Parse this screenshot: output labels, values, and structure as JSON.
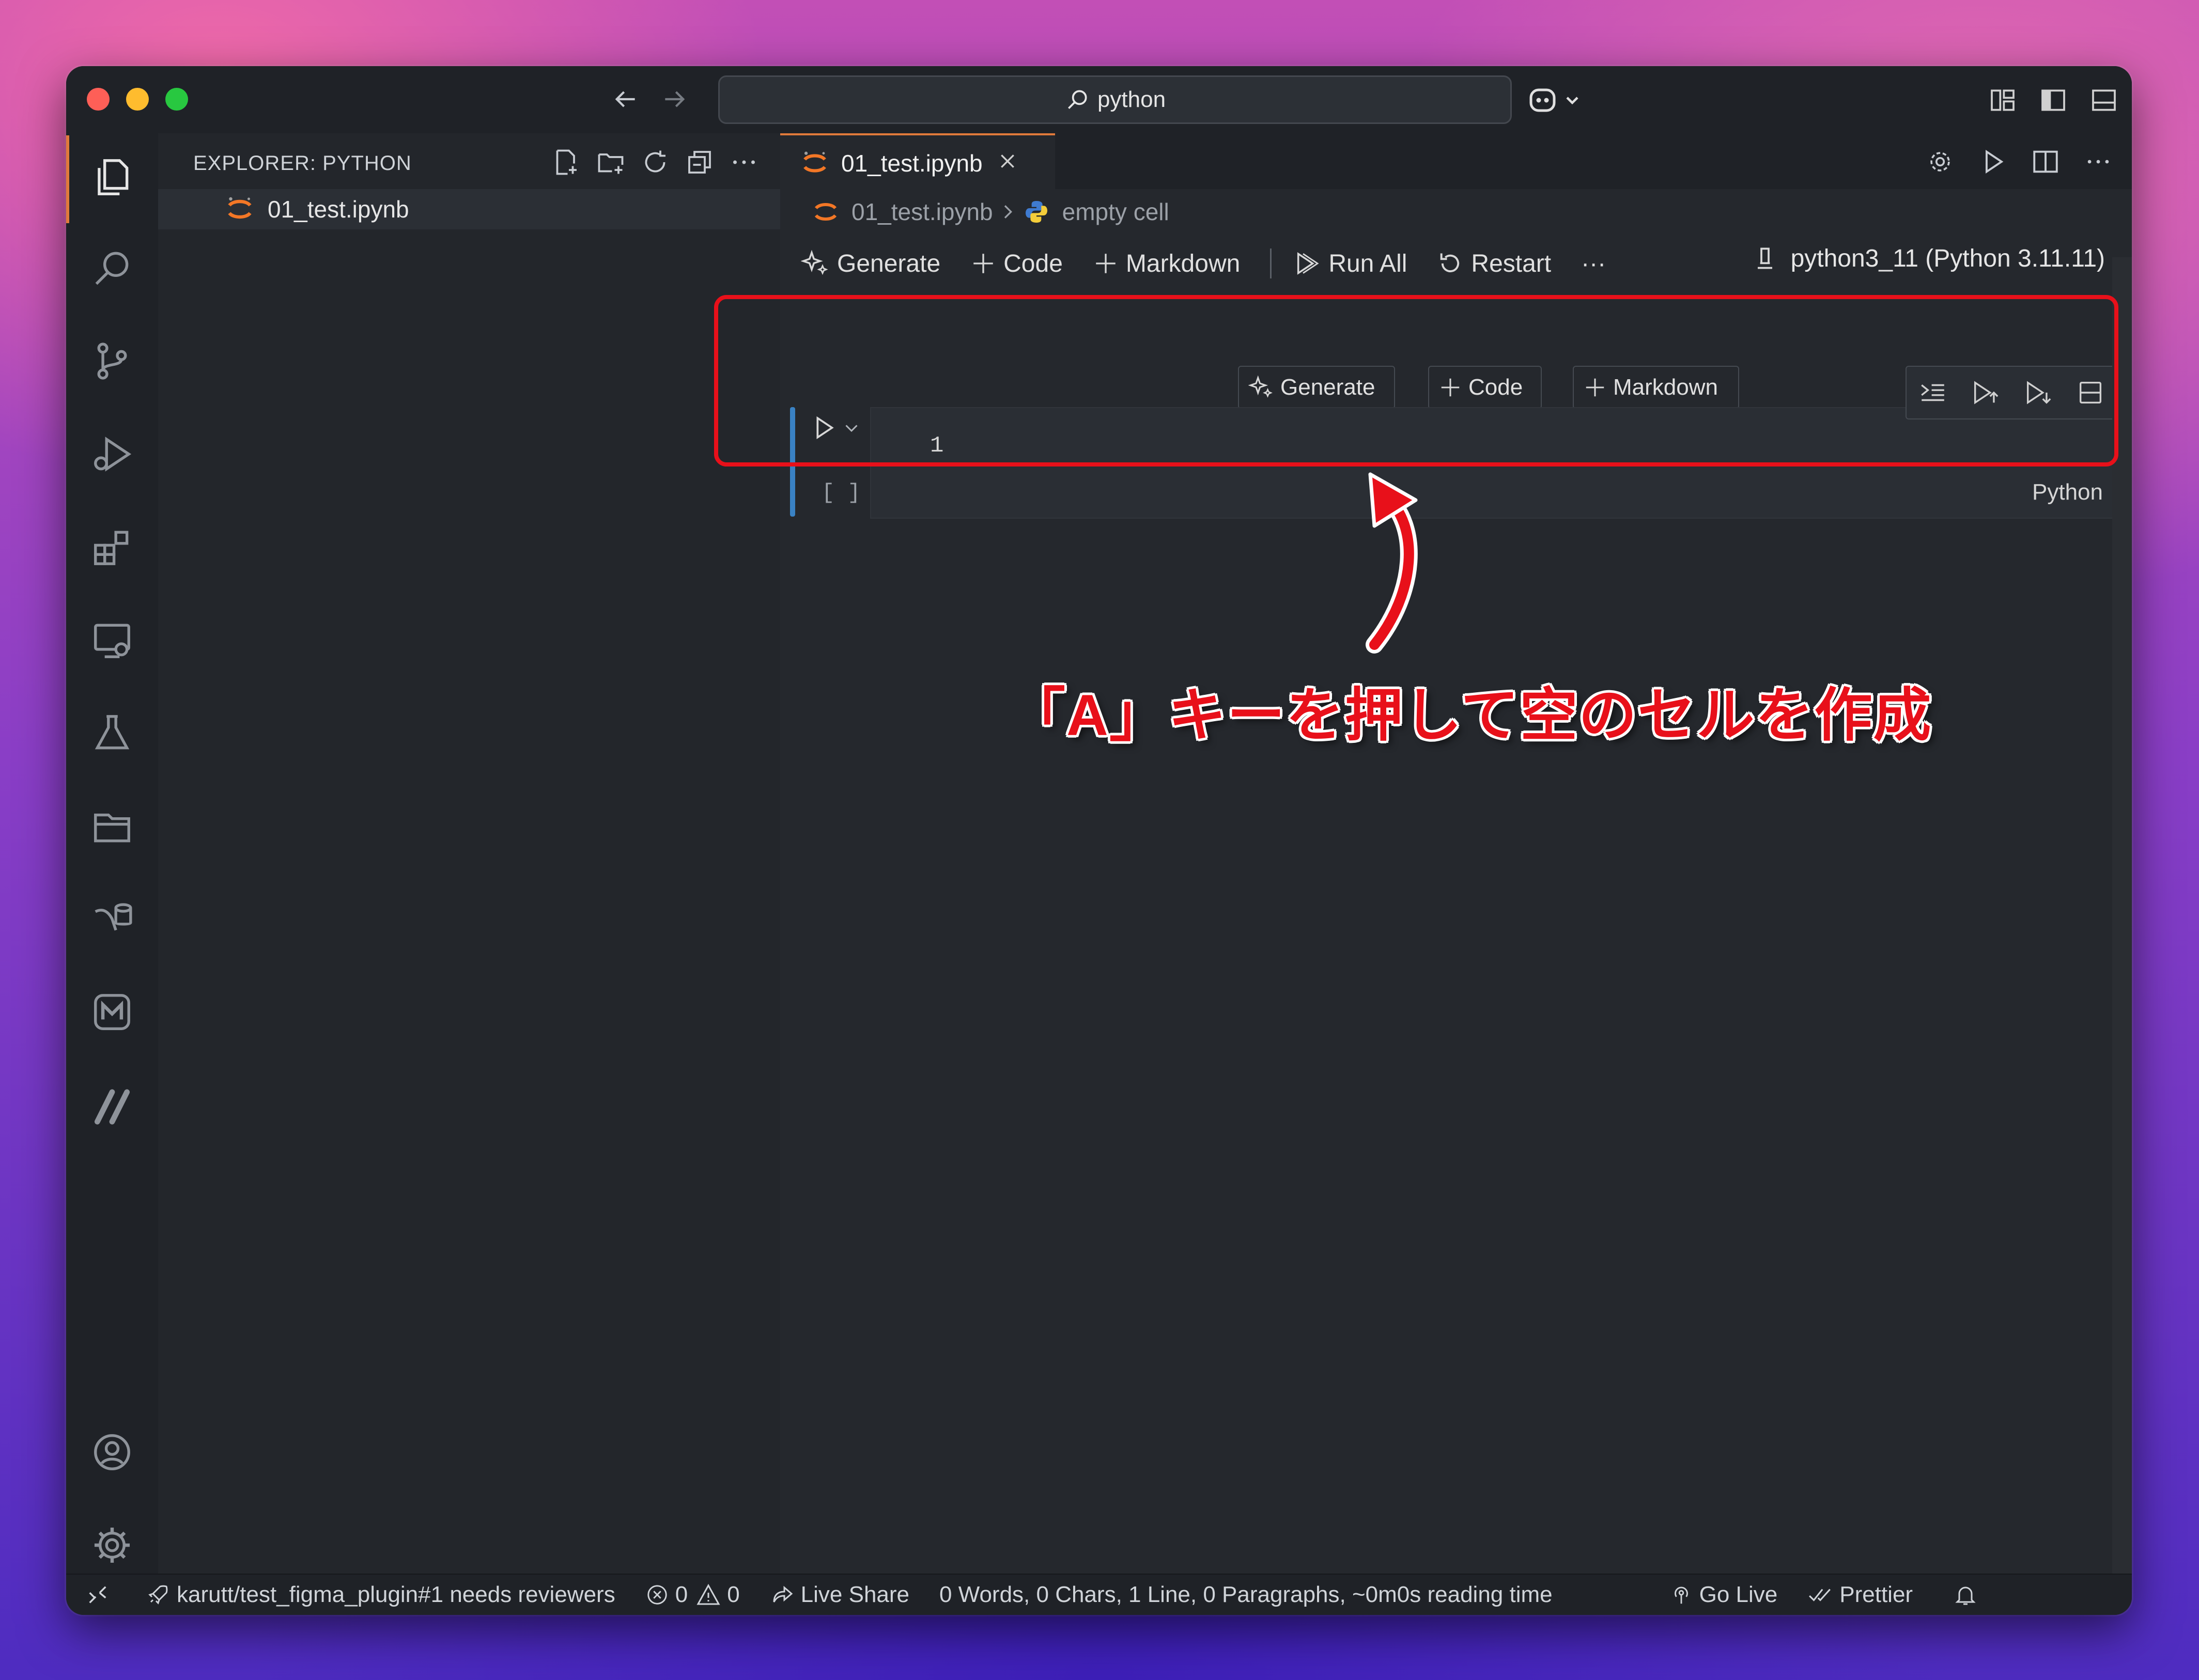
{
  "titlebar": {
    "search_text": "python"
  },
  "sidebar": {
    "title": "EXPLORER: PYTHON",
    "files": [
      {
        "name": "01_test.ipynb"
      }
    ]
  },
  "editor": {
    "tab": {
      "label": "01_test.ipynb"
    },
    "breadcrumb": {
      "file": "01_test.ipynb",
      "cell": "empty cell"
    },
    "toolbar": {
      "generate": "Generate",
      "code": "Code",
      "markdown": "Markdown",
      "run_all": "Run All",
      "restart": "Restart",
      "more": "···"
    },
    "kernel": "python3_11 (Python 3.11.11)",
    "cell_insert": {
      "generate": "Generate",
      "code": "Code",
      "markdown": "Markdown"
    },
    "cell": {
      "line_number": "1",
      "language": "Python",
      "exec_count": "[ ]"
    }
  },
  "annotation": {
    "text": "「A」キーを押して空のセルを作成",
    "color": "#e8101a"
  },
  "statusbar": {
    "pr": "karutt/test_figma_plugin#1 needs reviewers",
    "errors": "0",
    "warnings": "0",
    "live_share": "Live Share",
    "word_count": "0 Words, 0 Chars, 1 Line, 0 Paragraphs, ~0m0s reading time",
    "go_live": "Go Live",
    "prettier": "Prettier"
  },
  "colors": {
    "accent": "#e07a3b",
    "cell_indicator": "#3a82c4",
    "window_bg": "#25282d"
  }
}
